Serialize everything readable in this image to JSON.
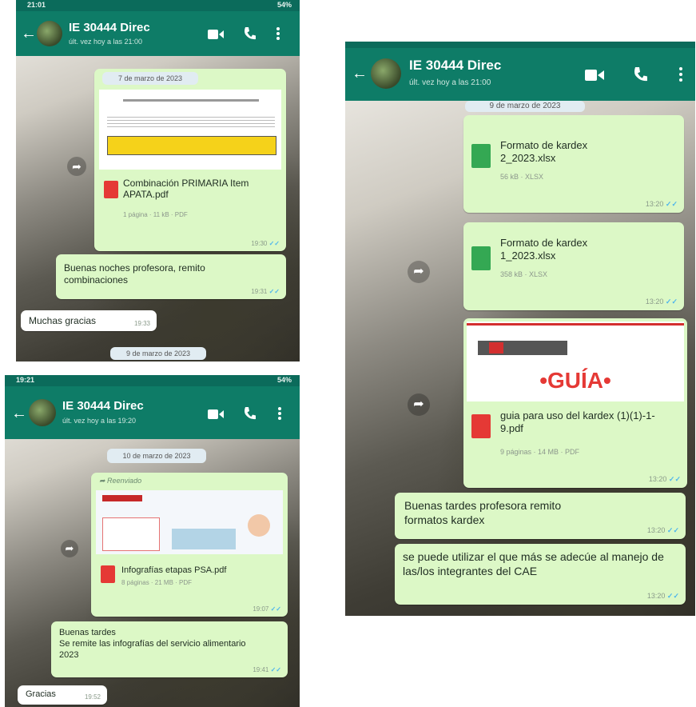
{
  "colors": {
    "header": "#0e7c67",
    "outgoing_bubble": "#dcf8c6",
    "incoming_bubble": "#ffffff",
    "read_ticks": "#4fb6ec",
    "pdf_icon": "#e53935",
    "xlsx_icon": "#34a853"
  },
  "icons": {
    "back": "arrow-left",
    "video": "video-camera",
    "call": "phone",
    "menu": "more-vertical",
    "forward": "share-arrow",
    "pdf": "pdf-file",
    "xlsx": "spreadsheet-file"
  },
  "s1": {
    "status_time": "21:01",
    "status_right": "54%",
    "name": "IE 30444 Direc",
    "subtitle": "últ. vez hoy a las 21:00",
    "date1": "7 de marzo de 2023",
    "file_name": "Combinación PRIMARIA Item APATA.pdf",
    "file_meta": "1 página · 11 kB · PDF",
    "file_time": "19:30",
    "msg1": "Buenas noches profesora, remito combinaciones",
    "msg1_time": "19:31",
    "msg2": "Muchas gracias",
    "msg2_time": "19:33",
    "date2": "9 de marzo de 2023"
  },
  "s2": {
    "status_time": "19:21",
    "status_right": "54%",
    "name": "IE 30444 Direc",
    "subtitle": "últ. vez hoy a las 19:20",
    "date1": "10 de marzo de 2023",
    "forwarded": "Reenviado",
    "file_name": "Infografías etapas PSA.pdf",
    "file_meta": "8 páginas · 21 MB · PDF",
    "file_time": "19:07",
    "msg1_line1": "Buenas tardes",
    "msg1_line2": "Se remite las infografías del servicio alimentario 2023",
    "msg1_time": "19:41",
    "msg2": "Gracias",
    "msg2_time": "19:52"
  },
  "s3": {
    "name": "IE 30444 Direc",
    "subtitle": "últ. vez hoy a las 21:00",
    "date1": "9 de marzo de 2023",
    "file1_name": "Formato de kardex 2_2023.xlsx",
    "file1_meta": "56 kB · XLSX",
    "file1_time": "13:20",
    "file2_name": "Formato de kardex 1_2023.xlsx",
    "file2_meta": "358 kB · XLSX",
    "file2_time": "13:20",
    "guide_title": "•GUÍA•",
    "file3_name": "guia para uso del kardex (1)(1)-1-9.pdf",
    "file3_meta": "9 páginas · 14 MB · PDF",
    "file3_time": "13:20",
    "msg1": "Buenas tardes profesora remito formatos kardex",
    "msg1_time": "13:20",
    "msg2": "se puede utilizar  el que más se adecúe al manejo de las/los integrantes del CAE",
    "msg2_time": "13:20"
  }
}
